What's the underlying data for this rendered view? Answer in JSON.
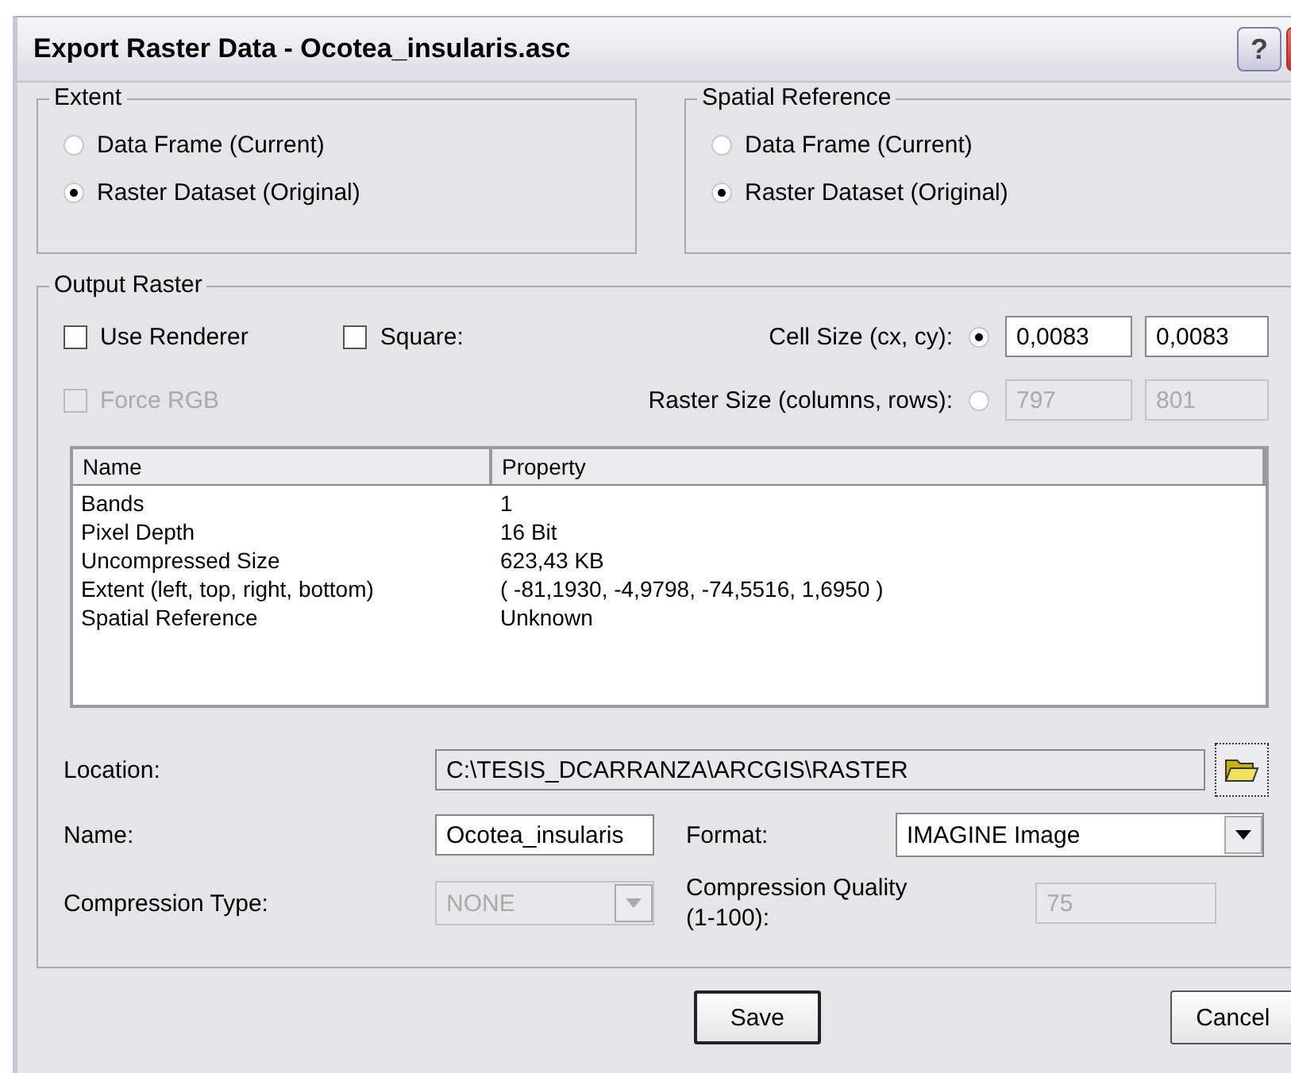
{
  "window": {
    "title": "Export Raster Data - Ocotea_insularis.asc",
    "help_button": "?"
  },
  "extent": {
    "label": "Extent",
    "options": [
      {
        "label": "Data Frame (Current)",
        "selected": false
      },
      {
        "label": "Raster Dataset (Original)",
        "selected": true
      }
    ]
  },
  "spatial_reference": {
    "label": "Spatial Reference",
    "options": [
      {
        "label": "Data Frame (Current)",
        "selected": false
      },
      {
        "label": "Raster Dataset (Original)",
        "selected": true
      }
    ]
  },
  "output_raster": {
    "label": "Output Raster",
    "checkboxes": [
      {
        "label": "Use Renderer",
        "checked": false,
        "disabled": false
      },
      {
        "label": "Square:",
        "checked": false,
        "disabled": false
      },
      {
        "label": "Force RGB",
        "checked": false,
        "disabled": true
      }
    ],
    "size_options": [
      {
        "label": "Cell Size (cx, cy):",
        "selected": true,
        "values": [
          "0,0083",
          "0,0083"
        ]
      },
      {
        "label": "Raster Size (columns, rows):",
        "selected": false,
        "values": [
          "797",
          "801"
        ]
      }
    ],
    "properties": {
      "columns": [
        "Name",
        "Property"
      ],
      "rows": [
        [
          "Bands",
          "1"
        ],
        [
          "Pixel Depth",
          "16 Bit"
        ],
        [
          "Uncompressed Size",
          "623,43 KB"
        ],
        [
          "Extent (left, top, right, bottom)",
          "( -81,1930, -4,9798, -74,5516, 1,6950 )"
        ],
        [
          "Spatial Reference",
          "Unknown"
        ]
      ]
    },
    "location": {
      "label": "Location:",
      "value": "C:\\TESIS_DCARRANZA\\ARCGIS\\RASTER"
    },
    "name": {
      "label": "Name:",
      "value": "Ocotea_insularis"
    },
    "format": {
      "label": "Format:",
      "value": "IMAGINE Image"
    },
    "compression_type": {
      "label": "Compression Type:",
      "value": "NONE",
      "disabled": true
    },
    "compression_quality": {
      "label": "Compression Quality (1-100):",
      "value": "75",
      "disabled": true
    }
  },
  "buttons": [
    {
      "label": "Save",
      "default": true
    },
    {
      "label": "Cancel",
      "default": false
    }
  ]
}
